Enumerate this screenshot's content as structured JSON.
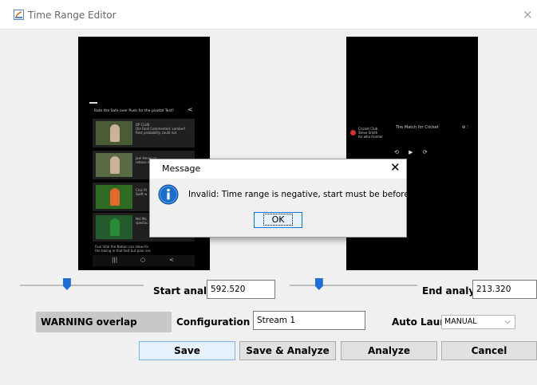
{
  "window": {
    "title": "Time Range Editor",
    "close_glyph": "×"
  },
  "left_preview": {
    "header": "Rate the Safe over Push for the pivotal Test?",
    "share_glyph": "<",
    "cards": [
      {
        "line1": "DP CLUB",
        "line2": "Ola Faoli Commented: Lambert",
        "line3": "Rest probability could not"
      },
      {
        "line1": "Joel Herwi pa:",
        "line2": "rebase de",
        "line3": ""
      },
      {
        "line1": "Croc M",
        "line2": "Swift w",
        "line3": ""
      },
      {
        "line1": "Nol Ma",
        "line2": "spectac",
        "line3": ""
      },
      {
        "line1": "Foul Vital the Nation can allow for",
        "line2": "the taking in that test but poor sec",
        "line3": ""
      }
    ],
    "nav": [
      "|||",
      "○",
      "<"
    ]
  },
  "right_preview": {
    "meta_line1": "Cricket Club",
    "meta_line2": "Steve Smith",
    "meta_line3": "for who frontier",
    "header_text": "The Match for Cricket",
    "header_right": "⚙ ⁝",
    "controls": "⟲ ▶ ⟳"
  },
  "sliders": {
    "start_value": 0.38,
    "end_value": 0.23
  },
  "fields": {
    "start_label": "Start analysis:",
    "start_value": "592.520",
    "end_label": "End analysis:",
    "end_value": "213.320",
    "warning": "WARNING overlap",
    "config_label": "Configuration name:",
    "config_value": "Stream 1",
    "autolaunch_label": "Auto Launch:",
    "autolaunch_value": "MANUAL",
    "dropdown_glyph": "⌵"
  },
  "buttons": {
    "save": "Save",
    "save_analyze": "Save & Analyze",
    "analyze": "Analyze",
    "cancel": "Cancel"
  },
  "dialog": {
    "title": "Message",
    "close_glyph": "✕",
    "message": "Invalid: Time range is negative, start must be before the end",
    "ok": "OK"
  },
  "colors": {
    "accent": "#1f6ed8",
    "info_icon": "#1c6fc8",
    "button_focus": "#e5f1fb"
  }
}
